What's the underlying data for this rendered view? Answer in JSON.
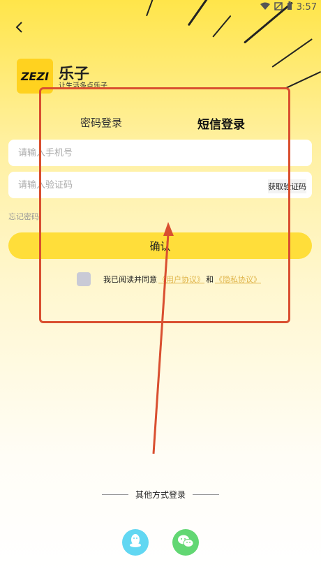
{
  "status_bar": {
    "time": "3:57"
  },
  "brand": {
    "logo_text": "ZEZI",
    "app_name": "乐子",
    "slogan": "让生活多点乐子"
  },
  "tabs": {
    "password": "密码登录",
    "sms": "短信登录"
  },
  "phone_input": {
    "placeholder": "请输入手机号"
  },
  "code_input": {
    "placeholder": "请输入验证码",
    "get_code_label": "获取验证码"
  },
  "forgot_password": "忘记密码",
  "confirm_button": "确认",
  "agreement": {
    "prefix": "我已阅读并同意",
    "user_agreement": "《用户协议》",
    "and": "和",
    "privacy_agreement": "《隐私协议》"
  },
  "other_login": {
    "label": "其他方式登录"
  },
  "colors": {
    "brand_yellow": "#FFDE3A",
    "annotation_red": "#D94F30",
    "qq_blue": "#62D7F2",
    "wechat_green": "#62D773"
  },
  "icons": [
    "back-arrow-icon",
    "wifi-icon",
    "signal-icon",
    "battery-icon",
    "qq-icon",
    "wechat-icon"
  ]
}
